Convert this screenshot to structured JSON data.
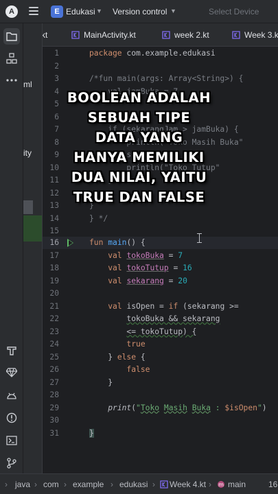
{
  "titlebar": {
    "logo_glyph": "A",
    "project_badge": "E",
    "project_name": "Edukasi",
    "vcs": "Version control",
    "device": "Select Device"
  },
  "project_panel": {
    "items": [
      "ml",
      "ity"
    ]
  },
  "tabs": [
    {
      "label": "kt"
    },
    {
      "label": "MainActivity.kt"
    },
    {
      "label": "week 2.kt"
    },
    {
      "label": "Week 3.kt"
    }
  ],
  "code": {
    "lines": [
      "1",
      "2",
      "3",
      "4",
      "5",
      "6",
      "7",
      "8",
      "9",
      "10",
      "11",
      "12",
      "13",
      "14",
      "15",
      "16",
      "17",
      "18",
      "19",
      "20",
      "21",
      "22",
      "23",
      "24",
      "25",
      "26",
      "27",
      "28",
      "29",
      "30",
      "31"
    ],
    "package_kw": "package",
    "package_name": " com.example.edukasi",
    "comment_open": "/*fun main(args: Array<String>) {",
    "comment_l4": "    val jamBuka = 7",
    "comment_l7": "    if (sekarangJam > jamBuka) {",
    "comment_l8": "        println(\"Toko Masih Buka\"",
    "comment_l9": "    } else {",
    "comment_l10": "        println(\"Toko Tutup\"",
    "comment_l11": "    }",
    "comment_l13": "}",
    "comment_close": "} */",
    "fun_kw": "fun",
    "main_fn": "main",
    "main_rest": "() {",
    "val_kw": "val",
    "v_tokoBuka": "tokoBuka",
    "n_7": "7",
    "v_tokoTutup": "tokoTutup",
    "n_16": "16",
    "v_sekarang": "sekarang",
    "n_20": "20",
    "v_isOpen": "isOpen",
    "if_kw": "if",
    "l21_rest": " (sekarang >=",
    "l22": "tokoBuka && sekarang",
    "l23": "<= tokoTutup) {",
    "true_kw": "true",
    "else_kw": "else",
    "false_kw": "false",
    "print_fn": "print",
    "str_open": "\"",
    "str_toko": "Toko",
    "str_masih": "Masih",
    "str_buka": "Buka",
    "str_colon": " : ",
    "str_tpl": "$isOpen",
    "str_close": "\"",
    "eq": " = "
  },
  "caption": {
    "lines": [
      "BOOLEAN ADALAH",
      "SEBUAH TIPE",
      "DATA YANG",
      "HANYA MEMILIKI",
      "DUA NILAI, YAITU",
      "TRUE DAN FALSE"
    ]
  },
  "breadcrumb": {
    "items": [
      "java",
      "com",
      "example",
      "edukasi",
      "Week 4.kt",
      "main"
    ],
    "position": "16"
  },
  "colors": {
    "accent": "#4a73d6",
    "keyword": "#cf8e6d",
    "function": "#56a8f5",
    "variable": "#c77dbb",
    "number": "#2aacb8",
    "string": "#6aab73",
    "run": "#5fb865"
  },
  "icons": {
    "left_strip": [
      "folder-icon",
      "structure-icon",
      "more-icon",
      "build-icon",
      "gem-icon",
      "android-icon",
      "problems-icon",
      "terminal-icon",
      "git-icon",
      "expand-icon"
    ]
  }
}
